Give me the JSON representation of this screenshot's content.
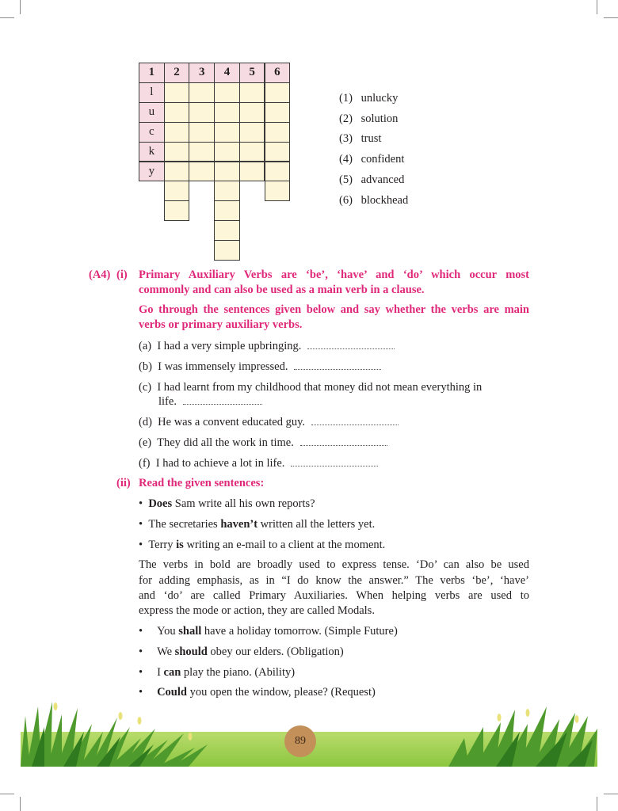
{
  "crossword": {
    "header": [
      "1",
      "2",
      "3",
      "4",
      "5",
      "6"
    ],
    "side_letters": [
      "l",
      "u",
      "c",
      "k",
      "y"
    ]
  },
  "clues": [
    {
      "num": "(1)",
      "word": "unlucky"
    },
    {
      "num": "(2)",
      "word": "solution"
    },
    {
      "num": "(3)",
      "word": "trust"
    },
    {
      "num": "(4)",
      "word": "confident"
    },
    {
      "num": "(5)",
      "word": "advanced"
    },
    {
      "num": "(6)",
      "word": "blockhead"
    }
  ],
  "a4": {
    "label": "(A4)",
    "part_i": {
      "label": "(i)",
      "intro_line1": "Primary Auxiliary Verbs are ‘be’, ‘have’ and ‘do’ which occur most",
      "intro_line2": "commonly and can also be used as a main verb in a clause.",
      "task_line1": "Go through the sentences given below and say whether the verbs are main",
      "task_line2": "verbs or primary auxiliary verbs.",
      "items": [
        {
          "label": "(a)",
          "text": "I had a very simple upbringing."
        },
        {
          "label": "(b)",
          "text": "I was immensely impressed."
        },
        {
          "label": "(c)",
          "text": "I had learnt from my childhood that money did not mean everything in",
          "text2": "life."
        },
        {
          "label": "(d)",
          "text": "He was a convent educated guy."
        },
        {
          "label": "(e)",
          "text": "They did all the work in time."
        },
        {
          "label": "(f)",
          "text": "I had to achieve a lot in life."
        }
      ]
    },
    "part_ii": {
      "label": "(ii)",
      "heading": "Read the given sentences:",
      "bullets": [
        {
          "bold": "Does",
          "rest": " Sam write all his own reports?",
          "pre": ""
        },
        {
          "pre": "The secretaries ",
          "bold": "haven’t",
          "rest": " written all the letters yet."
        },
        {
          "pre": "Terry ",
          "bold": "is",
          "rest": " writing an e-mail to a client at the moment."
        }
      ],
      "para": [
        "The verbs in bold are broadly used to express tense. ‘Do’ can also be used",
        "for adding emphasis, as in “I do know the answer.” The verbs ‘be’, ‘have’",
        "and ‘do’ are called Primary Auxiliaries. When helping verbs are used to",
        "express the mode or action, they are called Modals."
      ],
      "modals": [
        {
          "pre": "You ",
          "bold": "shall",
          "rest": " have a holiday tomorrow. (Simple Future)"
        },
        {
          "pre": "We ",
          "bold": "should",
          "rest": " obey our elders. (Obligation)"
        },
        {
          "pre": "I ",
          "bold": "can",
          "rest": " play the piano. (Ability)"
        },
        {
          "pre": "",
          "bold": "Could",
          "rest": " you open the window, please? (Request)"
        }
      ]
    }
  },
  "page_number": "89",
  "colors": {
    "pink": "#e0287a",
    "grid_header": "#f7dbe3",
    "grid_blank": "#fef6d8",
    "grass": "#8cc63f"
  }
}
